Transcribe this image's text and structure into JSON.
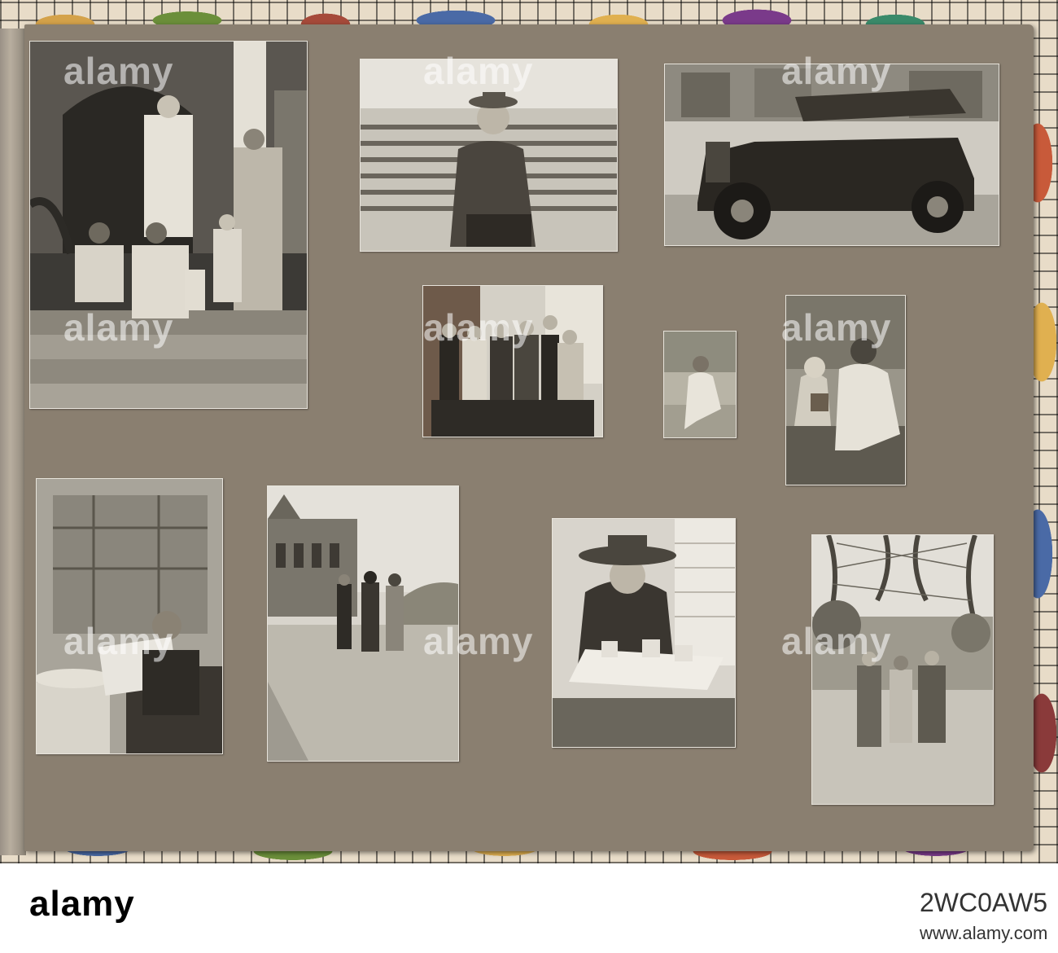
{
  "album": {
    "photos": [
      {
        "id": "family-on-steps"
      },
      {
        "id": "man-on-bench"
      },
      {
        "id": "vintage-car"
      },
      {
        "id": "group-by-wall"
      },
      {
        "id": "woman-seated-small"
      },
      {
        "id": "woman-with-child"
      },
      {
        "id": "man-reading-newspaper"
      },
      {
        "id": "group-before-building"
      },
      {
        "id": "woman-at-cafe-table"
      },
      {
        "id": "trio-under-tower"
      }
    ]
  },
  "watermark": {
    "text": "alamy"
  },
  "footer": {
    "logo": "alamy",
    "image_id": "2WC0AW5",
    "url": "www.alamy.com"
  }
}
